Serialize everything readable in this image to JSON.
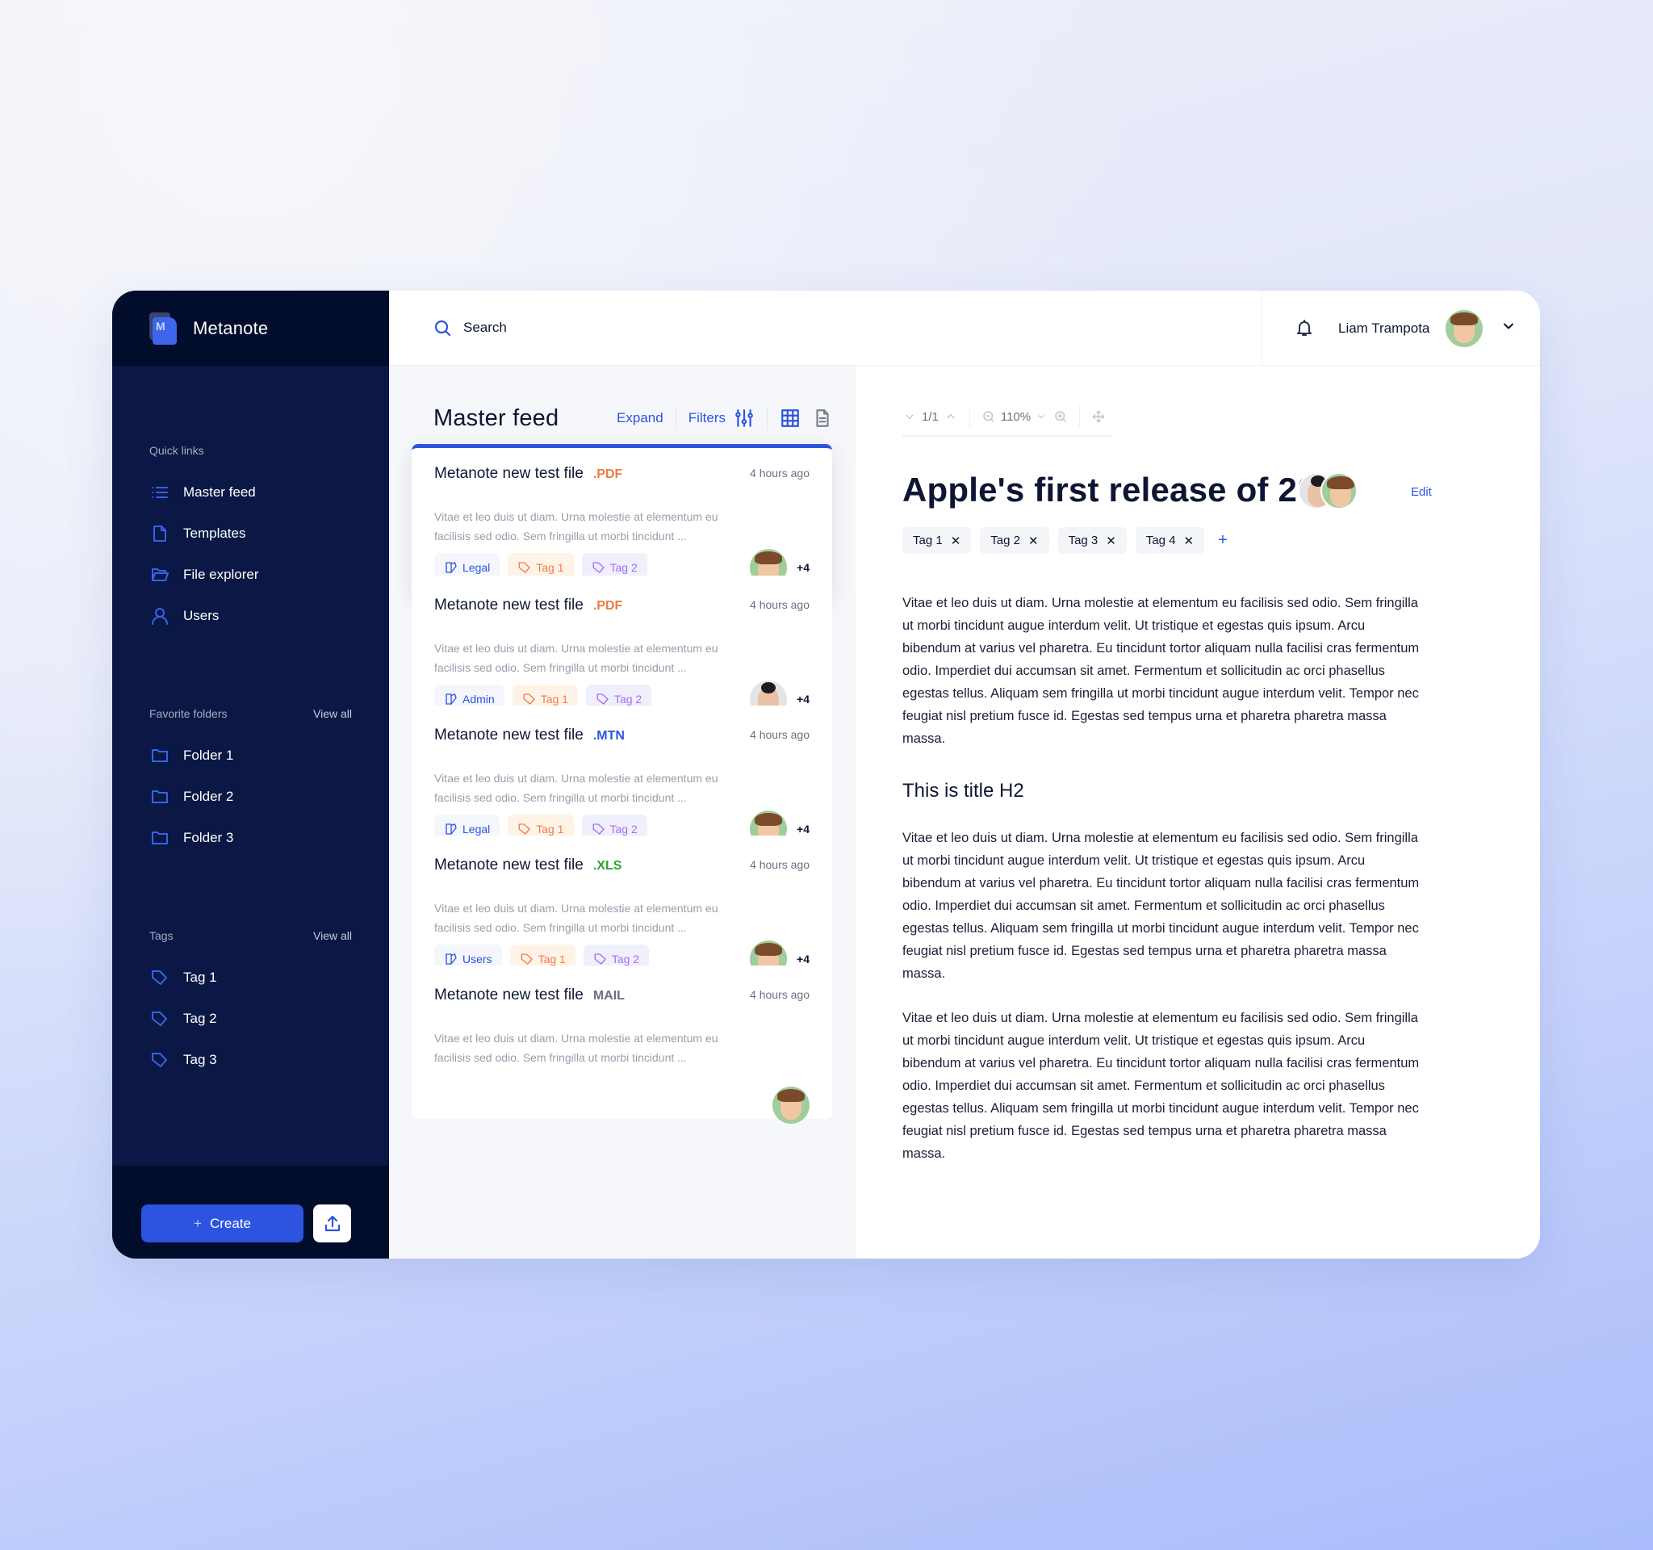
{
  "app": {
    "name": "Metanote",
    "logo_letter": "M"
  },
  "sidebar": {
    "quick_links_label": "Quick links",
    "quick_links": [
      {
        "label": "Master feed",
        "icon": "list-icon"
      },
      {
        "label": "Templates",
        "icon": "file-icon"
      },
      {
        "label": "File explorer",
        "icon": "folder-open-icon"
      },
      {
        "label": "Users",
        "icon": "user-icon"
      }
    ],
    "favorites_label": "Favorite folders",
    "favorites_view_all": "View all",
    "folders": [
      {
        "label": "Folder 1"
      },
      {
        "label": "Folder 2"
      },
      {
        "label": "Folder 3"
      }
    ],
    "tags_label": "Tags",
    "tags_view_all": "View all",
    "tags": [
      {
        "label": "Tag 1"
      },
      {
        "label": "Tag 2"
      },
      {
        "label": "Tag 3"
      }
    ],
    "create_label": "Create",
    "create_icon": "+",
    "upload_icon": "upload-icon"
  },
  "header": {
    "search_placeholder": "Search",
    "user_name": "Liam Trampota"
  },
  "feed": {
    "title": "Master feed",
    "expand_label": "Expand",
    "filters_label": "Filters",
    "cards": [
      {
        "title": "Metanote new test file",
        "ext": ".PDF",
        "ext_color": "#ee7b45",
        "time": "4 hours ago",
        "desc": "Vitae et leo duis ut diam. Urna molestie at elementum eu facilisis sed odio. Sem fringilla ut morbi tincidunt ...",
        "category": "Legal",
        "tag1": "Tag 1",
        "tag2": "Tag 2",
        "extra": "+4",
        "active": true
      },
      {
        "title": "Metanote new test file",
        "ext": ".PDF",
        "ext_color": "#ee7b45",
        "time": "4 hours ago",
        "desc": "Vitae et leo duis ut diam. Urna molestie at elementum eu facilisis sed odio. Sem fringilla ut morbi tincidunt ...",
        "category": "Admin",
        "tag1": "Tag 1",
        "tag2": "Tag 2",
        "extra": "+4",
        "active": false
      },
      {
        "title": "Metanote new test file",
        "ext": ".MTN",
        "ext_color": "#2c54e0",
        "time": "4 hours ago",
        "desc": "Vitae et leo duis ut diam. Urna molestie at elementum eu facilisis sed odio. Sem fringilla ut morbi tincidunt ...",
        "category": "Legal",
        "tag1": "Tag 1",
        "tag2": "Tag 2",
        "extra": "+4",
        "active": false
      },
      {
        "title": "Metanote new test file",
        "ext": ".XLS",
        "ext_color": "#2aa52e",
        "time": "4 hours ago",
        "desc": "Vitae et leo duis ut diam. Urna molestie at elementum eu facilisis sed odio. Sem fringilla ut morbi tincidunt ...",
        "category": "Users",
        "tag1": "Tag 1",
        "tag2": "Tag 2",
        "extra": "+4",
        "active": false
      },
      {
        "title": "Metanote new test file",
        "ext": "MAIL",
        "ext_color": "#6b7083",
        "time": "4 hours ago",
        "desc": "Vitae et leo duis ut diam. Urna molestie at elementum eu facilisis sed odio. Sem fringilla ut morbi tincidunt ...",
        "category": "",
        "tag1": "",
        "tag2": "",
        "extra": "",
        "active": false
      }
    ]
  },
  "document": {
    "page": "1/1",
    "zoom": "110%",
    "title": "Apple's first release of 2023",
    "edit_label": "Edit",
    "tags": [
      "Tag 1",
      "Tag 2",
      "Tag 3",
      "Tag 4"
    ],
    "add_tag": "+",
    "remove_glyph": "✕",
    "paragraph1": "Vitae et leo duis ut diam. Urna molestie at elementum eu facilisis sed odio. Sem fringilla ut morbi tincidunt augue interdum velit. Ut tristique et egestas quis ipsum. Arcu bibendum at varius vel pharetra. Eu tincidunt tortor aliquam nulla facilisi cras fermentum odio. Imperdiet dui accumsan sit amet. Fermentum et sollicitudin ac orci phasellus egestas tellus. Aliquam sem fringilla ut morbi tincidunt augue interdum velit. Tempor nec feugiat nisl pretium fusce id. Egestas sed tempus urna et pharetra pharetra massa massa.",
    "h2": "This is title H2",
    "paragraph2": "Vitae et leo duis ut diam. Urna molestie at elementum eu facilisis sed odio. Sem fringilla ut morbi tincidunt augue interdum velit. Ut tristique et egestas quis ipsum. Arcu bibendum at varius vel pharetra. Eu tincidunt tortor aliquam nulla facilisi cras fermentum odio. Imperdiet dui accumsan sit amet. Fermentum et sollicitudin ac orci phasellus egestas tellus. Aliquam sem fringilla ut morbi tincidunt augue interdum velit. Tempor nec feugiat nisl pretium fusce id. Egestas sed tempus urna et pharetra pharetra massa massa.",
    "paragraph3": "Vitae et leo duis ut diam. Urna molestie at elementum eu facilisis sed odio. Sem fringilla ut morbi tincidunt augue interdum velit. Ut tristique et egestas quis ipsum. Arcu bibendum at varius vel pharetra. Eu tincidunt tortor aliquam nulla facilisi cras fermentum odio. Imperdiet dui accumsan sit amet. Fermentum et sollicitudin ac orci phasellus egestas tellus. Aliquam sem fringilla ut morbi tincidunt augue interdum velit. Tempor nec feugiat nisl pretium fusce id. Egestas sed tempus urna et pharetra pharetra massa massa."
  },
  "colors": {
    "accent": "#2c54e0",
    "sidebar": "#0b1845",
    "sidebar_dark": "#020c2b",
    "pdf": "#ee7b45",
    "xls": "#2aa52e",
    "tag_purple": "#a56ef0"
  }
}
